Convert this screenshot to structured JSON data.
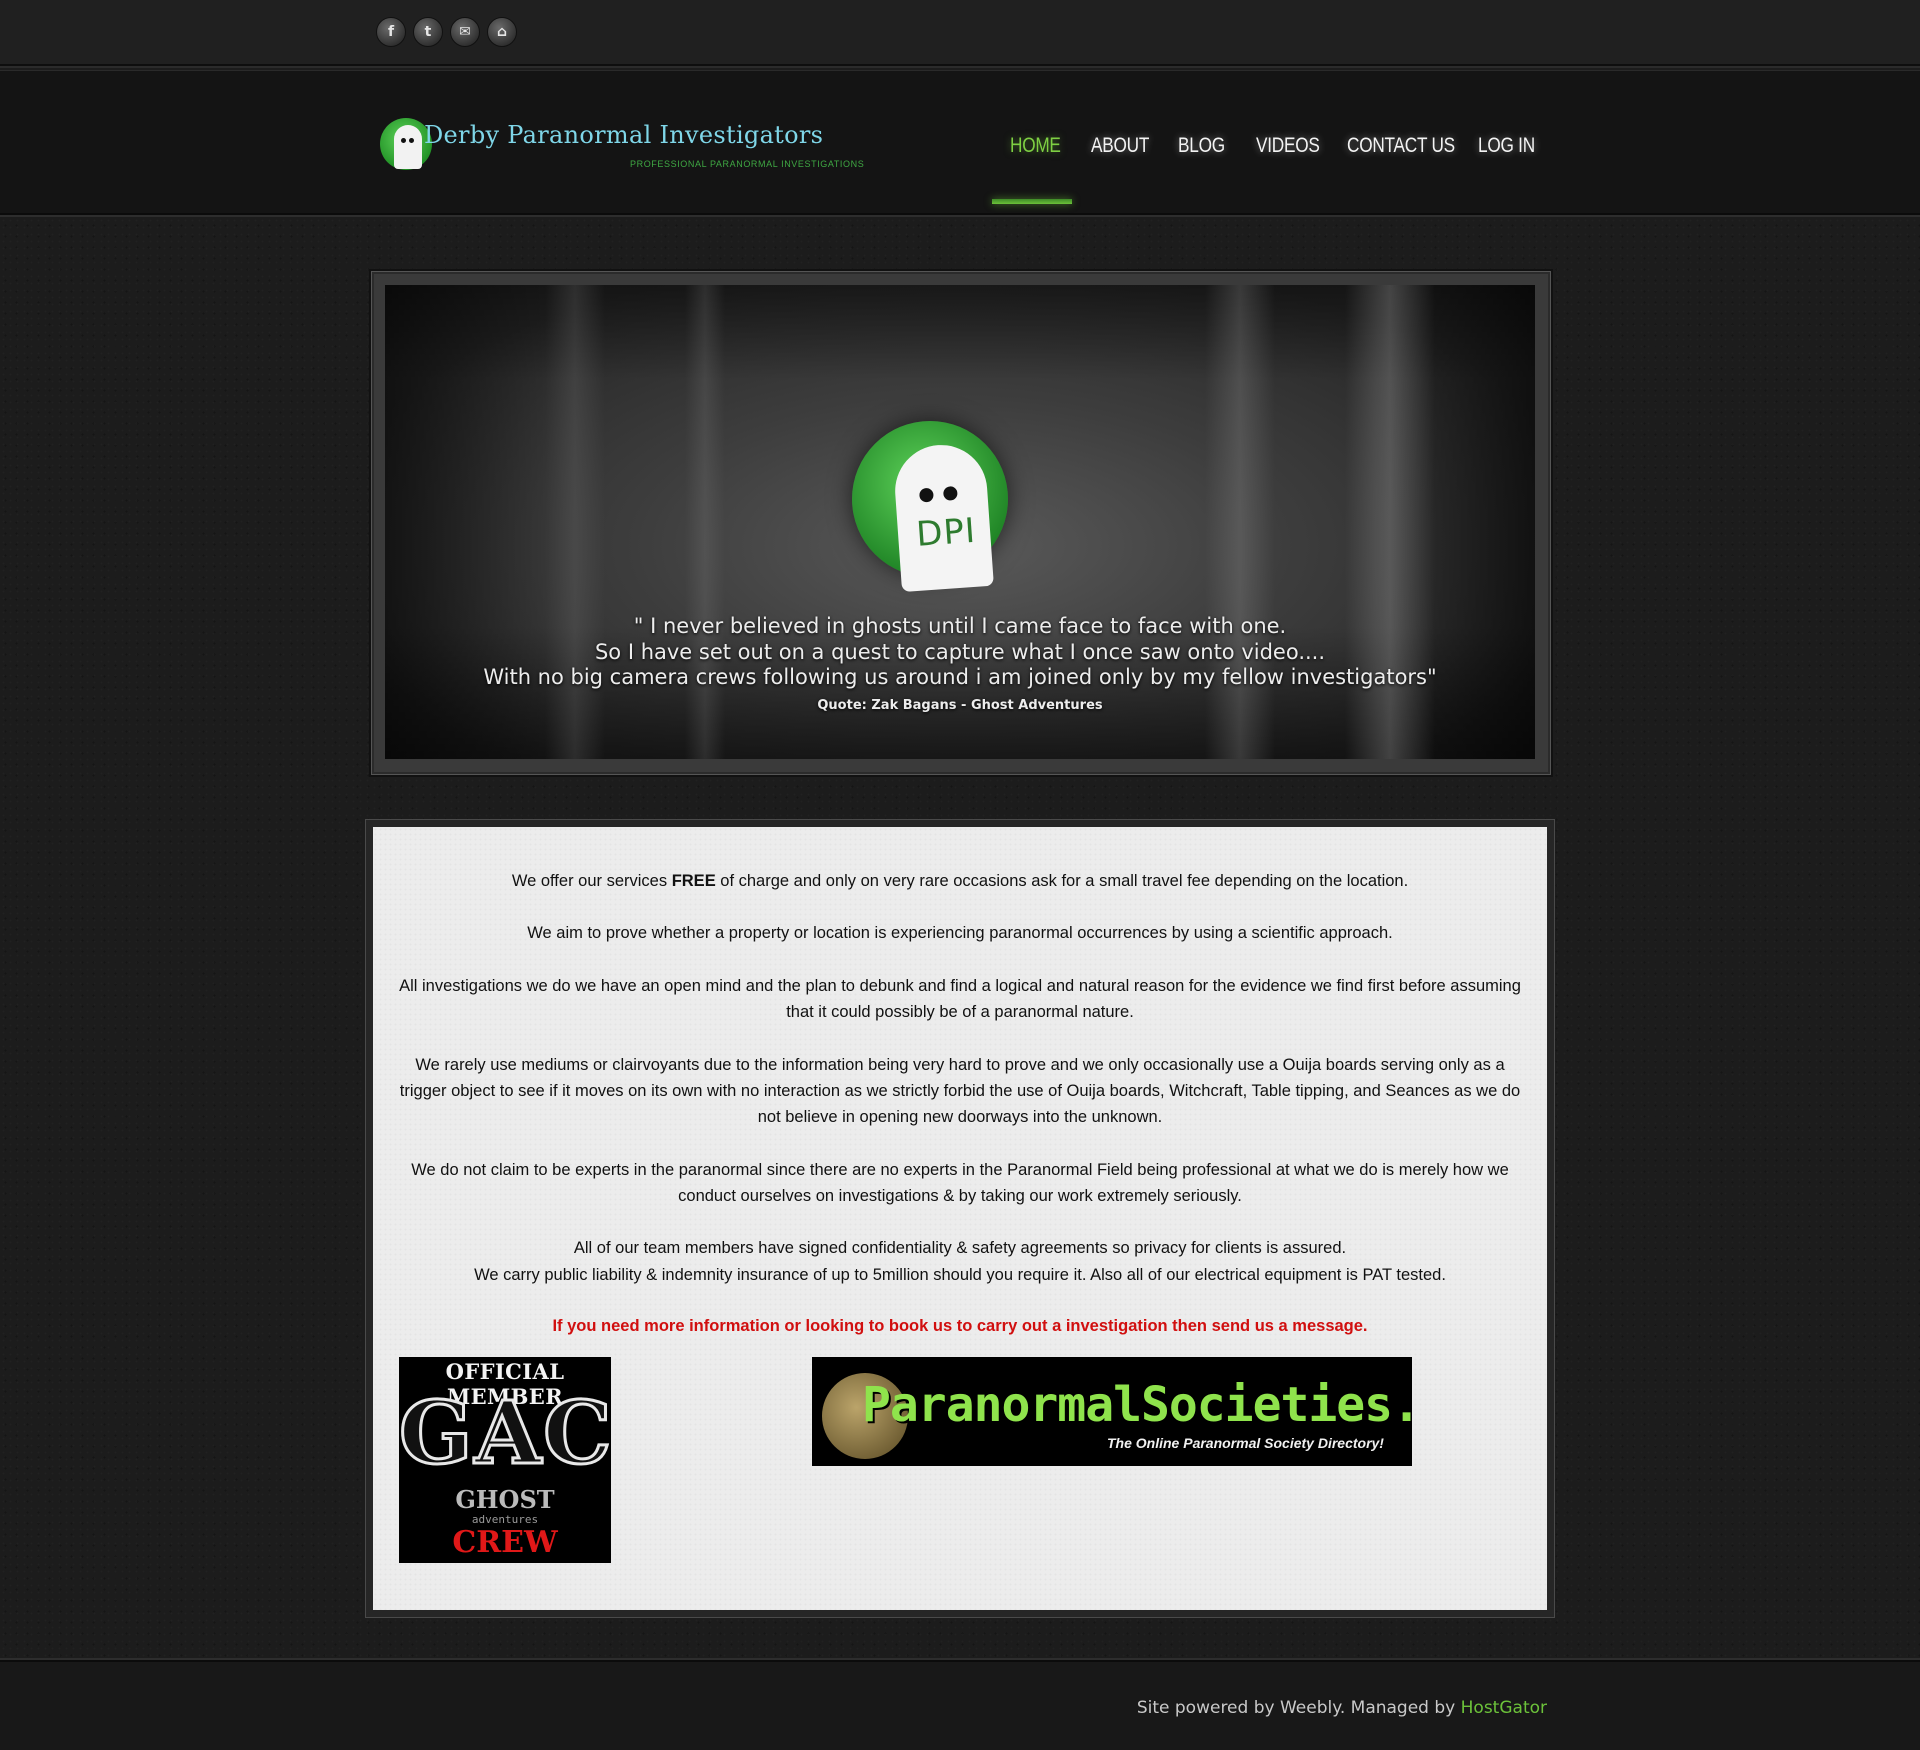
{
  "social": {
    "items": [
      {
        "icon": "facebook-icon",
        "glyph": "f"
      },
      {
        "icon": "twitter-icon",
        "glyph": "t"
      },
      {
        "icon": "email-icon",
        "glyph": "✉"
      },
      {
        "icon": "rss-icon",
        "glyph": "⌂"
      }
    ]
  },
  "header": {
    "logo_title": "Derby Paranormal Investigators",
    "logo_subtitle": "PROFESSIONAL PARANORMAL INVESTIGATIONS"
  },
  "nav": {
    "active": "HOME",
    "items": [
      "HOME",
      "ABOUT",
      "BLOG",
      "VIDEOS",
      "CONTACT US",
      "LOG IN"
    ],
    "accent_color": "#7ed043"
  },
  "banner": {
    "logo_text": "DPI",
    "quote_line1": "\" I never believed in ghosts until I came face to face with one.",
    "quote_line2": "So I have set out on a quest to capture what I once saw onto video....",
    "quote_line3": "With no big camera crews following us around i am joined only by my fellow investigators\"",
    "attribution": "Quote: Zak Bagans - Ghost Adventures"
  },
  "content": {
    "p1_before": "We offer our services ",
    "p1_bold": "FREE",
    "p1_after": " of charge and only on very rare occasions ask for a small travel fee depending on the location.",
    "p2": "We aim to prove whether a property or location is experiencing paranormal occurrences by using a scientific approach.",
    "p3": "All investigations we do we have an open mind and the plan to debunk and find a logical and natural reason for the evidence  we find first before assuming that it could possibly be of a paranormal nature.",
    "p4": "We rarely use mediums or clairvoyants due to the information being very hard to prove and we only occasionally use a Ouija boards serving only as a trigger object to see if it moves on its own with no interaction as we strictly forbid the use of Ouija boards, Witchcraft, Table tipping, and Seances as we do not believe in opening new doorways into the unknown.",
    "p5": "We do not claim to be experts in the paranormal since there are no experts in the Paranormal Field being professional at what we do is merely how we conduct ourselves on investigations & by taking our work extremely seriously.",
    "p6a": "All of our team members have signed confidentiality & safety agreements so privacy for clients is assured.",
    "p6b": "We  carry public liability & indemnity insurance of up to 5million should you require it. Also all of our electrical equipment is PAT tested.",
    "cta": "If you need more information or looking to book us to  carry out a investigation then send us a message.",
    "cta_color": "#d10f0f"
  },
  "badges": {
    "gac_top": "OFFICIAL MEMBER",
    "gac_main": "GAC",
    "gac_ghost": "GHOST",
    "gac_adventures": "adventures",
    "gac_crew": "CREW",
    "ps_title": "ParanormalSocieties.com",
    "ps_subtitle": "The Online Paranormal Society Directory!"
  },
  "footer": {
    "text": "Site powered by Weebly. Managed by ",
    "link": "HostGator",
    "link_color": "#6cc23a"
  }
}
